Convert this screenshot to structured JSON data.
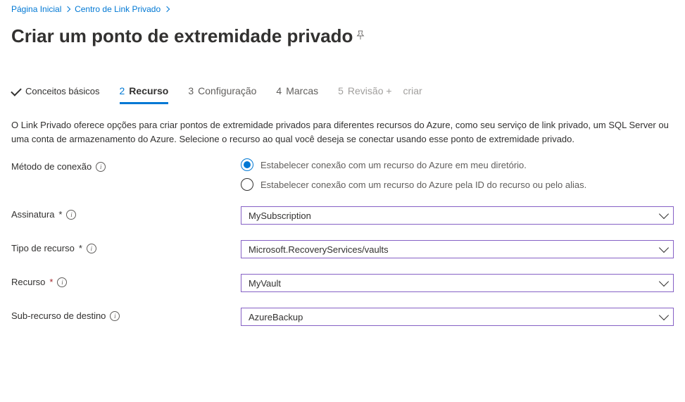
{
  "breadcrumb": {
    "home": "Página Inicial",
    "center": "Centro de Link Privado"
  },
  "page": {
    "title": "Criar um ponto de extremidade privado"
  },
  "tabs": {
    "t1": "Conceitos básicos",
    "t2_num": "2",
    "t2": "Recurso",
    "t3_num": "3",
    "t3": "Configuração",
    "t4_num": "4",
    "t4": "Marcas",
    "t5_num": "5",
    "t5": "Revisão +",
    "t5b": "criar"
  },
  "description": "O Link Privado oferece opções para criar pontos de extremidade privados para diferentes recursos do Azure, como seu serviço de link privado, um SQL Server ou uma conta de armazenamento do Azure. Selecione o recurso ao qual você deseja se conectar usando esse ponto de extremidade privado.",
  "form": {
    "method_label": "Método de conexão",
    "method_opt1": "Estabelecer conexão com um recurso do Azure em meu diretório.",
    "method_opt2": "Estabelecer conexão com um recurso do Azure pela ID do recurso ou pelo alias.",
    "sub_label": "Assinatura",
    "sub_value": "MySubscription",
    "type_label": "Tipo de recurso",
    "type_value": "Microsoft.RecoveryServices/vaults",
    "res_label": "Recurso",
    "res_value": "MyVault",
    "subres_label": "Sub-recurso de destino",
    "subres_value": "AzureBackup"
  }
}
